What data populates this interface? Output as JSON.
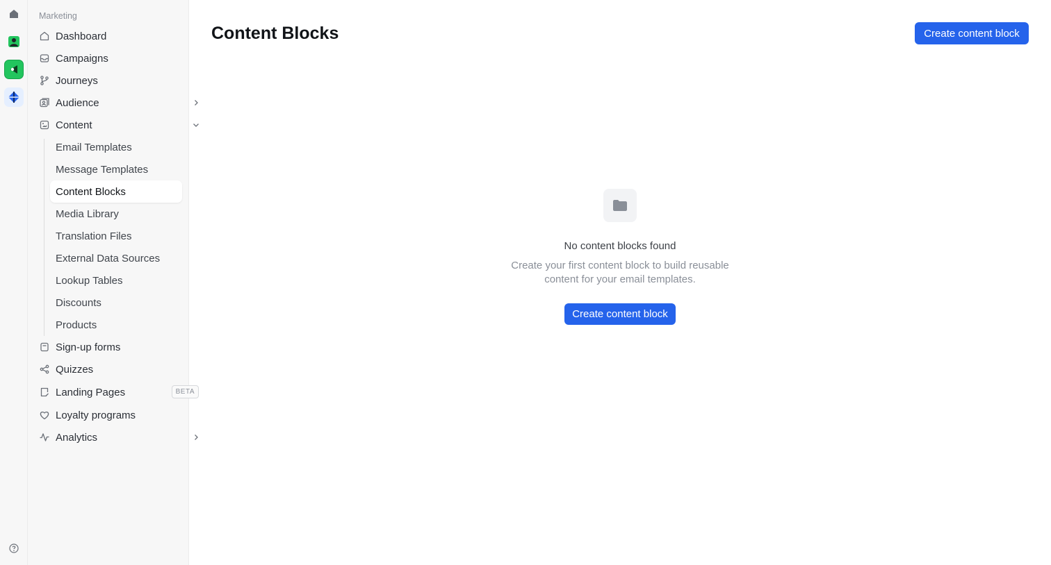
{
  "sidebar": {
    "section_label": "Marketing",
    "items": {
      "dashboard": "Dashboard",
      "campaigns": "Campaigns",
      "journeys": "Journeys",
      "audience": "Audience",
      "content": "Content",
      "signup_forms": "Sign-up forms",
      "quizzes": "Quizzes",
      "landing_pages": "Landing Pages",
      "landing_pages_badge": "BETA",
      "loyalty_programs": "Loyalty programs",
      "analytics": "Analytics"
    },
    "content_subitems": [
      "Email Templates",
      "Message Templates",
      "Content Blocks",
      "Media Library",
      "Translation Files",
      "External Data Sources",
      "Lookup Tables",
      "Discounts",
      "Products"
    ],
    "active_subitem": "Content Blocks"
  },
  "main": {
    "title": "Content Blocks",
    "create_button": "Create content block",
    "empty_state": {
      "icon": "folder-icon",
      "title": "No content blocks found",
      "description": "Create your first content block to build reusable content for your email templates.",
      "button": "Create content block"
    }
  },
  "colors": {
    "primary": "#2563eb",
    "sidebar_bg": "#f7f7f7",
    "app_green": "#22c55e"
  }
}
